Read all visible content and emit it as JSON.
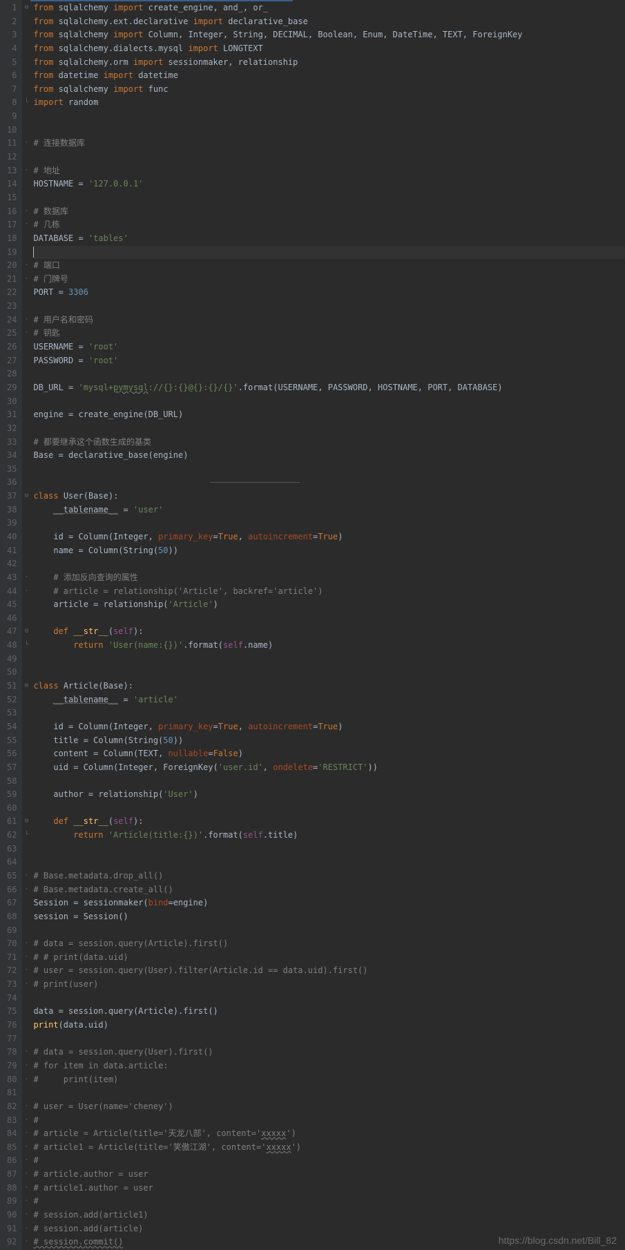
{
  "watermark": "https://blog.csdn.net/Bill_82",
  "lines": [
    {
      "n": 1,
      "f": "⊟",
      "t": [
        {
          "c": "kw",
          "s": "from"
        },
        {
          "s": " sqlalchemy "
        },
        {
          "c": "kw",
          "s": "import"
        },
        {
          "s": " create_engine, and_, or_"
        }
      ]
    },
    {
      "n": 2,
      "t": [
        {
          "c": "kw",
          "s": "from"
        },
        {
          "s": " sqlalchemy.ext.declarative "
        },
        {
          "c": "kw",
          "s": "import"
        },
        {
          "s": " declarative_base"
        }
      ]
    },
    {
      "n": 3,
      "t": [
        {
          "c": "kw",
          "s": "from"
        },
        {
          "s": " sqlalchemy "
        },
        {
          "c": "kw",
          "s": "import"
        },
        {
          "s": " Column, Integer, String, DECIMAL, Boolean, Enum, DateTime, TEXT, ForeignKey"
        }
      ]
    },
    {
      "n": 4,
      "t": [
        {
          "c": "kw",
          "s": "from"
        },
        {
          "s": " sqlalchemy.dialects.mysql "
        },
        {
          "c": "kw",
          "s": "import"
        },
        {
          "s": " LONGTEXT"
        }
      ]
    },
    {
      "n": 5,
      "t": [
        {
          "c": "kw",
          "s": "from"
        },
        {
          "s": " sqlalchemy.orm "
        },
        {
          "c": "kw",
          "s": "import"
        },
        {
          "s": " sessionmaker, relationship"
        }
      ]
    },
    {
      "n": 6,
      "t": [
        {
          "c": "kw",
          "s": "from"
        },
        {
          "s": " datetime "
        },
        {
          "c": "kw",
          "s": "import"
        },
        {
          "s": " datetime"
        }
      ]
    },
    {
      "n": 7,
      "t": [
        {
          "c": "kw",
          "s": "from"
        },
        {
          "s": " sqlalchemy "
        },
        {
          "c": "kw",
          "s": "import"
        },
        {
          "s": " func"
        }
      ]
    },
    {
      "n": 8,
      "f": "└",
      "t": [
        {
          "c": "kw",
          "s": "import"
        },
        {
          "s": " random"
        }
      ]
    },
    {
      "n": 9,
      "t": []
    },
    {
      "n": 10,
      "t": []
    },
    {
      "n": 11,
      "f": "·",
      "t": [
        {
          "c": "cm",
          "s": "# 连接数据库"
        }
      ]
    },
    {
      "n": 12,
      "t": []
    },
    {
      "n": 13,
      "f": "·",
      "t": [
        {
          "c": "cm",
          "s": "# 地址"
        }
      ]
    },
    {
      "n": 14,
      "t": [
        {
          "s": "HOSTNAME = "
        },
        {
          "c": "str",
          "s": "'127.0.0.1'"
        }
      ]
    },
    {
      "n": 15,
      "t": []
    },
    {
      "n": 16,
      "f": "·",
      "t": [
        {
          "c": "cm",
          "s": "# 数据库"
        }
      ]
    },
    {
      "n": 17,
      "f": "·",
      "t": [
        {
          "c": "cm",
          "s": "# 几栋"
        }
      ]
    },
    {
      "n": 18,
      "t": [
        {
          "s": "DATABASE = "
        },
        {
          "c": "str",
          "s": "'tables'"
        }
      ]
    },
    {
      "n": 19,
      "cur": true,
      "t": [
        {
          "cursor": true
        }
      ]
    },
    {
      "n": 20,
      "f": "·",
      "t": [
        {
          "c": "cm",
          "s": "# 端口"
        }
      ]
    },
    {
      "n": 21,
      "f": "·",
      "t": [
        {
          "c": "cm",
          "s": "# 门牌号"
        }
      ]
    },
    {
      "n": 22,
      "t": [
        {
          "s": "PORT = "
        },
        {
          "c": "num",
          "s": "3306"
        }
      ]
    },
    {
      "n": 23,
      "t": []
    },
    {
      "n": 24,
      "f": "·",
      "t": [
        {
          "c": "cm",
          "s": "# 用户名和密码"
        }
      ]
    },
    {
      "n": 25,
      "f": "·",
      "t": [
        {
          "c": "cm",
          "s": "# 钥匙"
        }
      ]
    },
    {
      "n": 26,
      "t": [
        {
          "s": "USERNAME = "
        },
        {
          "c": "str",
          "s": "'root'"
        }
      ]
    },
    {
      "n": 27,
      "t": [
        {
          "s": "PASSWORD = "
        },
        {
          "c": "str",
          "s": "'root'"
        }
      ]
    },
    {
      "n": 28,
      "t": []
    },
    {
      "n": 29,
      "t": [
        {
          "s": "DB_URL = "
        },
        {
          "c": "str",
          "s": "'mysql+"
        },
        {
          "c": "str wavy",
          "s": "pymysql"
        },
        {
          "c": "str",
          "s": "://{}:{}@{}:{}/{}'"
        },
        {
          "s": ".format(USERNAME, PASSWORD, HOSTNAME, PORT, DATABASE)"
        }
      ]
    },
    {
      "n": 30,
      "t": []
    },
    {
      "n": 31,
      "t": [
        {
          "s": "engine = create_engine(DB_URL)"
        }
      ]
    },
    {
      "n": 32,
      "t": []
    },
    {
      "n": 33,
      "t": [
        {
          "c": "cm",
          "s": "# 都要继承这个函数生成的基类"
        }
      ]
    },
    {
      "n": 34,
      "t": [
        {
          "s": "Base = declarative_base(engine)"
        }
      ]
    },
    {
      "n": 35,
      "t": []
    },
    {
      "n": 36,
      "sep": true,
      "t": []
    },
    {
      "n": 37,
      "f": "⊟",
      "t": [
        {
          "c": "kw",
          "s": "class "
        },
        {
          "c": "cls",
          "s": "User"
        },
        {
          "s": "(Base):"
        }
      ]
    },
    {
      "n": 38,
      "t": [
        {
          "s": "    "
        },
        {
          "c": "dun",
          "s": "__tablename__"
        },
        {
          "s": " = "
        },
        {
          "c": "str",
          "s": "'user'"
        }
      ]
    },
    {
      "n": 39,
      "t": []
    },
    {
      "n": 40,
      "t": [
        {
          "s": "    id = Column(Integer, "
        },
        {
          "c": "pm",
          "s": "primary_key"
        },
        {
          "s": "="
        },
        {
          "c": "kw",
          "s": "True"
        },
        {
          "s": ", "
        },
        {
          "c": "pm",
          "s": "autoincrement"
        },
        {
          "s": "="
        },
        {
          "c": "kw",
          "s": "True"
        },
        {
          "s": ")"
        }
      ]
    },
    {
      "n": 41,
      "t": [
        {
          "s": "    name = Column(String("
        },
        {
          "c": "num",
          "s": "50"
        },
        {
          "s": "))"
        }
      ]
    },
    {
      "n": 42,
      "t": []
    },
    {
      "n": 43,
      "f": "·",
      "t": [
        {
          "s": "    "
        },
        {
          "c": "cm",
          "s": "# 添加反向查询的属性"
        }
      ]
    },
    {
      "n": 44,
      "f": "·",
      "t": [
        {
          "s": "    "
        },
        {
          "c": "cm",
          "s": "# article = relationship('Article', backref='article')"
        }
      ]
    },
    {
      "n": 45,
      "t": [
        {
          "s": "    article = relationship("
        },
        {
          "c": "str",
          "s": "'Article'"
        },
        {
          "s": ")"
        }
      ]
    },
    {
      "n": 46,
      "t": []
    },
    {
      "n": 47,
      "f": "⊟",
      "t": [
        {
          "s": "    "
        },
        {
          "c": "kw",
          "s": "def "
        },
        {
          "c": "fn",
          "s": "__str__"
        },
        {
          "s": "("
        },
        {
          "c": "sf",
          "s": "self"
        },
        {
          "s": "):"
        }
      ]
    },
    {
      "n": 48,
      "f": "└",
      "t": [
        {
          "s": "        "
        },
        {
          "c": "kw",
          "s": "return "
        },
        {
          "c": "str",
          "s": "'User(name:{})'"
        },
        {
          "s": ".format("
        },
        {
          "c": "sf",
          "s": "self"
        },
        {
          "s": ".name)"
        }
      ]
    },
    {
      "n": 49,
      "t": []
    },
    {
      "n": 50,
      "t": []
    },
    {
      "n": 51,
      "f": "⊟",
      "t": [
        {
          "c": "kw",
          "s": "class "
        },
        {
          "c": "cls",
          "s": "Article"
        },
        {
          "s": "(Base):"
        }
      ]
    },
    {
      "n": 52,
      "t": [
        {
          "s": "    "
        },
        {
          "c": "dun",
          "s": "__tablename__"
        },
        {
          "s": " = "
        },
        {
          "c": "str",
          "s": "'article'"
        }
      ]
    },
    {
      "n": 53,
      "t": []
    },
    {
      "n": 54,
      "t": [
        {
          "s": "    id = Column(Integer, "
        },
        {
          "c": "pm",
          "s": "primary_key"
        },
        {
          "s": "="
        },
        {
          "c": "kw",
          "s": "True"
        },
        {
          "s": ", "
        },
        {
          "c": "pm",
          "s": "autoincrement"
        },
        {
          "s": "="
        },
        {
          "c": "kw",
          "s": "True"
        },
        {
          "s": ")"
        }
      ]
    },
    {
      "n": 55,
      "t": [
        {
          "s": "    title = Column(String("
        },
        {
          "c": "num",
          "s": "50"
        },
        {
          "s": "))"
        }
      ]
    },
    {
      "n": 56,
      "t": [
        {
          "s": "    content = Column(TEXT, "
        },
        {
          "c": "pm",
          "s": "nullable"
        },
        {
          "s": "="
        },
        {
          "c": "kw",
          "s": "False"
        },
        {
          "s": ")"
        }
      ]
    },
    {
      "n": 57,
      "t": [
        {
          "s": "    uid = Column(Integer, ForeignKey("
        },
        {
          "c": "str",
          "s": "'user.id'"
        },
        {
          "s": ", "
        },
        {
          "c": "pm",
          "s": "ondelete"
        },
        {
          "s": "="
        },
        {
          "c": "str",
          "s": "'RESTRICT'"
        },
        {
          "s": "))"
        }
      ]
    },
    {
      "n": 58,
      "t": []
    },
    {
      "n": 59,
      "t": [
        {
          "s": "    author = relationship("
        },
        {
          "c": "str",
          "s": "'User'"
        },
        {
          "s": ")"
        }
      ]
    },
    {
      "n": 60,
      "t": []
    },
    {
      "n": 61,
      "f": "⊟",
      "t": [
        {
          "s": "    "
        },
        {
          "c": "kw",
          "s": "def "
        },
        {
          "c": "fn",
          "s": "__str__"
        },
        {
          "s": "("
        },
        {
          "c": "sf",
          "s": "self"
        },
        {
          "s": "):"
        }
      ]
    },
    {
      "n": 62,
      "f": "└",
      "t": [
        {
          "s": "        "
        },
        {
          "c": "kw",
          "s": "return "
        },
        {
          "c": "str",
          "s": "'Article(title:{})'"
        },
        {
          "s": ".format("
        },
        {
          "c": "sf",
          "s": "self"
        },
        {
          "s": ".title)"
        }
      ]
    },
    {
      "n": 63,
      "t": []
    },
    {
      "n": 64,
      "t": []
    },
    {
      "n": 65,
      "f": "·",
      "t": [
        {
          "c": "cm",
          "s": "# Base.metadata.drop_all()"
        }
      ]
    },
    {
      "n": 66,
      "f": "·",
      "t": [
        {
          "c": "cm",
          "s": "# Base.metadata.create_all()"
        }
      ]
    },
    {
      "n": 67,
      "t": [
        {
          "s": "Session = sessionmaker("
        },
        {
          "c": "pm",
          "s": "bind"
        },
        {
          "s": "=engine)"
        }
      ]
    },
    {
      "n": 68,
      "t": [
        {
          "s": "session = Session()"
        }
      ]
    },
    {
      "n": 69,
      "t": []
    },
    {
      "n": 70,
      "f": "·",
      "t": [
        {
          "c": "cm",
          "s": "# data = session.query(Article).first()"
        }
      ]
    },
    {
      "n": 71,
      "f": "·",
      "t": [
        {
          "c": "cm",
          "s": "# # print(data.uid)"
        }
      ]
    },
    {
      "n": 72,
      "f": "·",
      "t": [
        {
          "c": "cm",
          "s": "# user = session.query(User).filter(Article.id == data.uid).first()"
        }
      ]
    },
    {
      "n": 73,
      "f": "·",
      "t": [
        {
          "c": "cm",
          "s": "# print(user)"
        }
      ]
    },
    {
      "n": 74,
      "t": []
    },
    {
      "n": 75,
      "t": [
        {
          "s": "data = session.query(Article).first()"
        }
      ]
    },
    {
      "n": 76,
      "t": [
        {
          "c": "fn",
          "s": "print"
        },
        {
          "s": "(data.uid)"
        }
      ]
    },
    {
      "n": 77,
      "t": []
    },
    {
      "n": 78,
      "f": "·",
      "t": [
        {
          "c": "cm",
          "s": "# data = session.query(User).first()"
        }
      ]
    },
    {
      "n": 79,
      "f": "·",
      "t": [
        {
          "c": "cm",
          "s": "# for item in data.article:"
        }
      ]
    },
    {
      "n": 80,
      "f": "·",
      "t": [
        {
          "c": "cm",
          "s": "#     print(item)"
        }
      ]
    },
    {
      "n": 81,
      "t": []
    },
    {
      "n": 82,
      "f": "·",
      "t": [
        {
          "c": "cm",
          "s": "# user = User(name='cheney')"
        }
      ]
    },
    {
      "n": 83,
      "f": "·",
      "t": [
        {
          "c": "cm",
          "s": "#"
        }
      ]
    },
    {
      "n": 84,
      "f": "·",
      "t": [
        {
          "c": "cm",
          "s": "# article = Article(title='天龙八部', content='"
        },
        {
          "c": "cm wavy",
          "s": "xxxxx"
        },
        {
          "c": "cm",
          "s": "')"
        }
      ]
    },
    {
      "n": 85,
      "f": "·",
      "t": [
        {
          "c": "cm",
          "s": "# article1 = Article(title='笑傲江湖', content='"
        },
        {
          "c": "cm wavy",
          "s": "xxxxx"
        },
        {
          "c": "cm",
          "s": "')"
        }
      ]
    },
    {
      "n": 86,
      "f": "·",
      "t": [
        {
          "c": "cm",
          "s": "#"
        }
      ]
    },
    {
      "n": 87,
      "f": "·",
      "t": [
        {
          "c": "cm",
          "s": "# article.author = user"
        }
      ]
    },
    {
      "n": 88,
      "f": "·",
      "t": [
        {
          "c": "cm",
          "s": "# article1.author = user"
        }
      ]
    },
    {
      "n": 89,
      "f": "·",
      "t": [
        {
          "c": "cm",
          "s": "#"
        }
      ]
    },
    {
      "n": 90,
      "f": "·",
      "t": [
        {
          "c": "cm",
          "s": "# session.add(article1)"
        }
      ]
    },
    {
      "n": 91,
      "f": "·",
      "t": [
        {
          "c": "cm",
          "s": "# session.add(article)"
        }
      ]
    },
    {
      "n": 92,
      "f": "·",
      "t": [
        {
          "c": "cm wavy",
          "s": "# session.commit()"
        }
      ]
    }
  ]
}
